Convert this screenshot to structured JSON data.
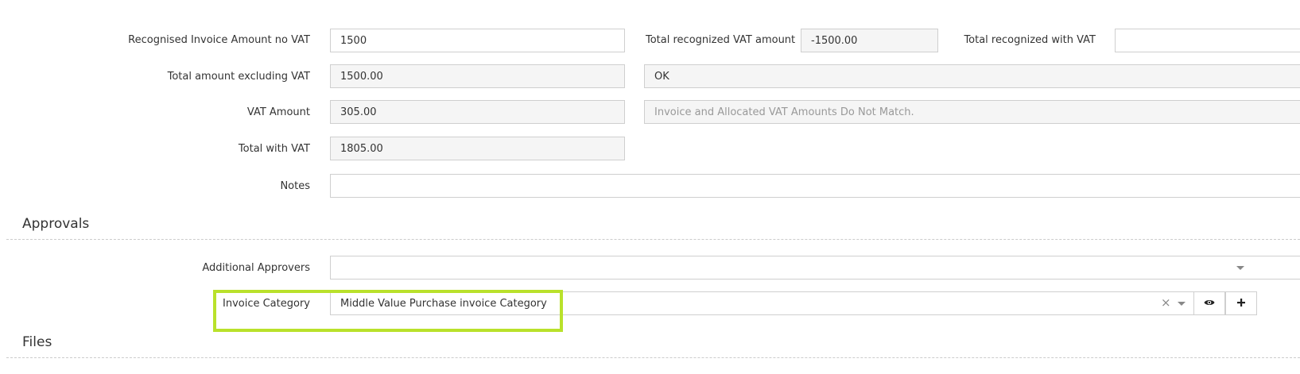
{
  "form": {
    "recognised_invoice_amount": {
      "label": "Recognised Invoice Amount no VAT",
      "value": "1500"
    },
    "total_recognized_vat": {
      "label": "Total recognized VAT amount",
      "value": "-1500.00"
    },
    "total_recognized_with_vat": {
      "label": "Total recognized with VAT",
      "value": ""
    },
    "total_excluding_vat": {
      "label": "Total amount excluding VAT",
      "value": "1500.00"
    },
    "amount_status": {
      "value": "OK"
    },
    "vat_amount": {
      "label": "VAT Amount",
      "value": "305.00"
    },
    "vat_status": {
      "value": "Invoice and Allocated VAT Amounts Do Not Match."
    },
    "total_with_vat": {
      "label": "Total with VAT",
      "value": "1805.00"
    },
    "notes": {
      "label": "Notes",
      "value": ""
    }
  },
  "approvals": {
    "title": "Approvals",
    "additional_approvers": {
      "label": "Additional Approvers",
      "value": ""
    },
    "invoice_category": {
      "label": "Invoice Category",
      "value": "Middle Value Purchase invoice Category"
    }
  },
  "files": {
    "title": "Files"
  },
  "icons": {
    "clear": "close-icon",
    "dropdown": "chevron-down-icon",
    "view": "eye-icon",
    "add": "plus-icon"
  },
  "colors": {
    "highlight": "#b9e12b",
    "readonly_bg": "#f5f5f5",
    "border": "#cfcfcf"
  }
}
